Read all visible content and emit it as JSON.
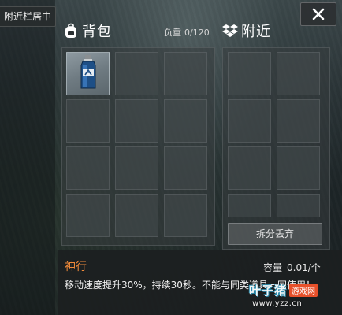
{
  "side_tab": {
    "label": "附近栏居中"
  },
  "close_button": {
    "label": "✕"
  },
  "backpack": {
    "title": "背包",
    "icon": "backpack-icon",
    "weight_label": "负重",
    "weight_value": "0/120"
  },
  "nearby": {
    "title": "附近",
    "icon": "dropbox-icon",
    "split_button": "拆分丢弃"
  },
  "selected_item": {
    "name": "神行",
    "capacity_label": "容量",
    "capacity_value": "0.01/个",
    "description": "移动速度提升30%，持续30秒。不能与同类道具一同使用！",
    "icon": "potion-bottle-icon"
  },
  "watermark": {
    "brand": "叶子猪",
    "tag": "游戏网",
    "url": "www.yzz.cn"
  },
  "colors": {
    "item_name": "#f08a3a",
    "panel": "#373c3e",
    "accent_blue": "#2e8fb0"
  }
}
